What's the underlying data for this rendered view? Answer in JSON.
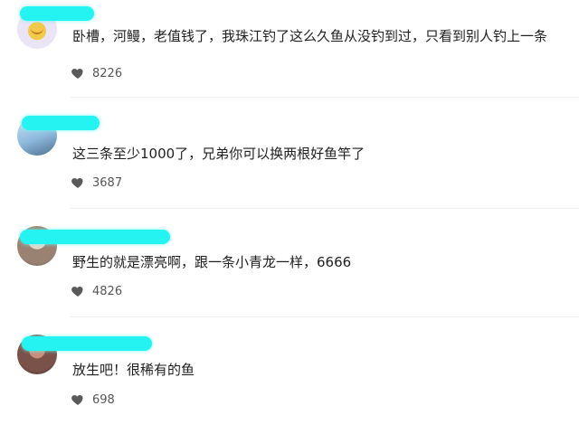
{
  "comments": [
    {
      "text": "卧槽，河鳗，老值钱了，我珠江钓了这么久鱼从没钓到过，只看到别人钓上一条",
      "likes": "8226"
    },
    {
      "text": "这三条至少1000了，兄弟你可以换两根好鱼竿了",
      "likes": "3687"
    },
    {
      "text": "野生的就是漂亮啊，跟一条小青龙一样，6666",
      "likes": "4826"
    },
    {
      "text": "放生吧！很稀有的鱼",
      "likes": "698"
    }
  ],
  "icons": {
    "like": "heart-icon"
  },
  "colors": {
    "redaction": "#24f3f1",
    "heart": "#5a5a5a",
    "divider": "#eeeeee"
  }
}
